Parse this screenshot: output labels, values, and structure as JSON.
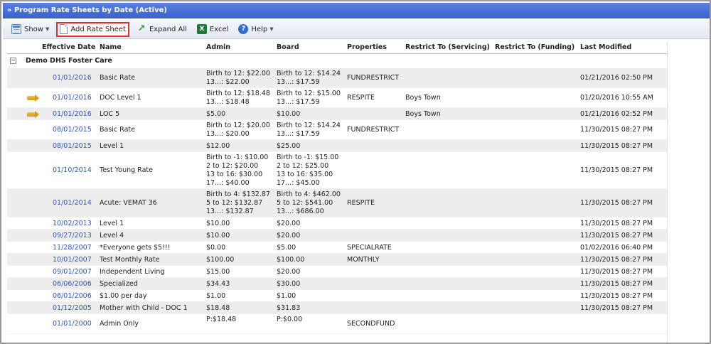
{
  "title": "» Program Rate Sheets by Date (Active)",
  "toolbar": {
    "show": "Show",
    "add": "Add Rate Sheet",
    "expand": "Expand All",
    "excel": "Excel",
    "help": "Help"
  },
  "columns": [
    "Effective Date",
    "Name",
    "Admin",
    "Board",
    "Properties",
    "Restrict To (Servicing)",
    "Restrict To (Funding)",
    "Last Modified"
  ],
  "group": {
    "toggle": "−",
    "label": "Demo DHS Foster Care"
  },
  "rows": [
    {
      "date": "01/01/2016",
      "name": "Basic Rate",
      "admin": [
        "Birth to 12: $22.00",
        "13...: $22.00"
      ],
      "board": [
        "Birth to 12: $14.24",
        "13...: $17.59"
      ],
      "props": "FUNDRESTRICT",
      "serv": "",
      "fund": "",
      "mod": "01/21/2016 02:50 PM",
      "arrow": false
    },
    {
      "date": "01/01/2016",
      "name": "DOC Level 1",
      "admin": [
        "Birth to 12: $18.48",
        "13...: $18.48"
      ],
      "board": [
        "Birth to 12: $15.00",
        "13...: $17.59"
      ],
      "props": "RESPITE",
      "serv": "Boys Town",
      "fund": "",
      "mod": "01/20/2016 10:55 AM",
      "arrow": true
    },
    {
      "date": "01/01/2016",
      "name": "LOC 5",
      "admin": [
        "$5.00"
      ],
      "board": [
        "$10.00"
      ],
      "props": "",
      "serv": "Boys Town",
      "fund": "",
      "mod": "01/21/2016 02:52 PM",
      "arrow": true
    },
    {
      "date": "08/01/2015",
      "name": "Basic Rate",
      "admin": [
        "Birth to 12: $20.00",
        "13...: $20.00"
      ],
      "board": [
        "Birth to 12: $14.24",
        "13...: $17.59"
      ],
      "props": "FUNDRESTRICT",
      "serv": "",
      "fund": "",
      "mod": "11/30/2015 08:27 PM",
      "arrow": false
    },
    {
      "date": "08/01/2015",
      "name": "Level 1",
      "admin": [
        "$12.00"
      ],
      "board": [
        "$25.00"
      ],
      "props": "",
      "serv": "",
      "fund": "",
      "mod": "11/30/2015 08:27 PM",
      "arrow": false
    },
    {
      "date": "01/10/2014",
      "name": "Test Young Rate",
      "admin": [
        "Birth to -1: $10.00",
        "2 to 12: $20.00",
        "13 to 16: $30.00",
        "17...: $40.00"
      ],
      "board": [
        "Birth to -1: $15.00",
        "2 to 12: $25.00",
        "13 to 16: $35.00",
        "17...: $45.00"
      ],
      "props": "",
      "serv": "",
      "fund": "",
      "mod": "11/30/2015 08:27 PM",
      "arrow": false
    },
    {
      "date": "01/01/2014",
      "name": "Acute: VEMAT 36",
      "admin": [
        "Birth to 4: $132.87",
        "5 to 12: $132.87",
        "13...: $132.87"
      ],
      "board": [
        "Birth to 4: $462.00",
        "5 to 12: $541.00",
        "13...: $686.00"
      ],
      "props": "RESPITE",
      "serv": "",
      "fund": "",
      "mod": "11/30/2015 08:27 PM",
      "arrow": false
    },
    {
      "date": "10/02/2013",
      "name": "Level 1",
      "admin": [
        "$10.00"
      ],
      "board": [
        "$20.00"
      ],
      "props": "",
      "serv": "",
      "fund": "",
      "mod": "11/30/2015 08:27 PM",
      "arrow": false
    },
    {
      "date": "09/27/2013",
      "name": "Level 4",
      "admin": [
        "$10.00"
      ],
      "board": [
        "$20.00"
      ],
      "props": "",
      "serv": "",
      "fund": "",
      "mod": "11/30/2015 08:27 PM",
      "arrow": false
    },
    {
      "date": "11/28/2007",
      "name": "*Everyone gets $5!!!",
      "admin": [
        "$0.00"
      ],
      "board": [
        "$5.00"
      ],
      "props": "SPECIALRATE",
      "serv": "",
      "fund": "",
      "mod": "01/02/2016 06:40 PM",
      "arrow": false
    },
    {
      "date": "10/01/2007",
      "name": "Test Monthly Rate",
      "admin": [
        "$100.00"
      ],
      "board": [
        "$100.00"
      ],
      "props": "MONTHLY",
      "serv": "",
      "fund": "",
      "mod": "11/30/2015 08:27 PM",
      "arrow": false
    },
    {
      "date": "09/01/2007",
      "name": "Independent Living",
      "admin": [
        "$15.00"
      ],
      "board": [
        "$20.00"
      ],
      "props": "",
      "serv": "",
      "fund": "",
      "mod": "11/30/2015 08:27 PM",
      "arrow": false
    },
    {
      "date": "06/06/2006",
      "name": "Specialized",
      "admin": [
        "$34.43"
      ],
      "board": [
        "$30.00"
      ],
      "props": "",
      "serv": "",
      "fund": "",
      "mod": "11/30/2015 08:27 PM",
      "arrow": false
    },
    {
      "date": "06/01/2006",
      "name": "$1.00 per day",
      "admin": [
        "$1.00"
      ],
      "board": [
        "$1.00"
      ],
      "props": "",
      "serv": "",
      "fund": "",
      "mod": "11/30/2015 08:27 PM",
      "arrow": false
    },
    {
      "date": "01/12/2005",
      "name": "Mother with Child - DOC 1",
      "admin": [
        "$18.48"
      ],
      "board": [
        "$31.83"
      ],
      "props": "",
      "serv": "",
      "fund": "",
      "mod": "11/30/2015 08:27 PM",
      "arrow": false
    },
    {
      "date": "01/01/2000",
      "name": "Admin Only",
      "admin": [
        "P:$18.48",
        ""
      ],
      "board": [
        "P:$0.00",
        ""
      ],
      "props": "SECONDFUND",
      "serv": "",
      "fund": "",
      "mod": "",
      "arrow": false
    }
  ]
}
